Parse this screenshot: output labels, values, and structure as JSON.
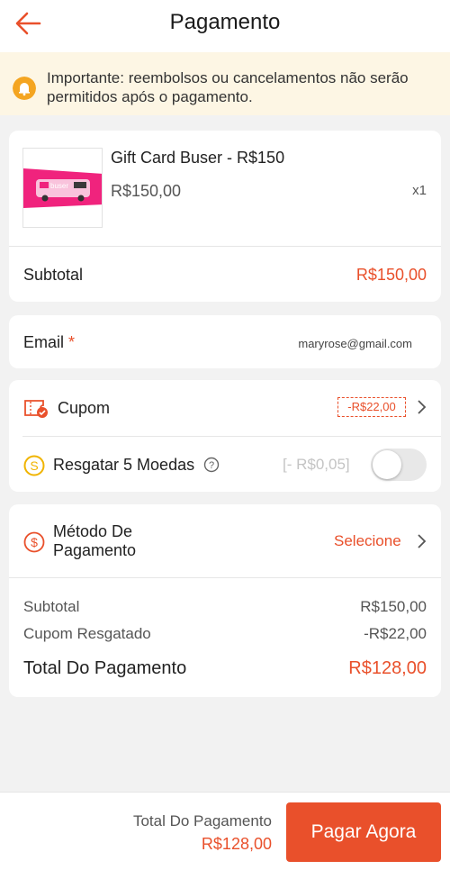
{
  "header": {
    "title": "Pagamento"
  },
  "notice": {
    "text": "Importante: reembolsos ou cancelamentos não serão permitidos após o pagamento."
  },
  "product": {
    "name": "Gift Card Buser - R$150",
    "price": "R$150,00",
    "quantity": "x1",
    "image_brand": "buser"
  },
  "subtotal_row": {
    "label": "Subtotal",
    "value": "R$150,00"
  },
  "email": {
    "label": "Email",
    "required_mark": "*",
    "value": "maryrose@gmail.com"
  },
  "coupon": {
    "label": "Cupom",
    "badge": "-R$22,00"
  },
  "coins": {
    "label": "Resgatar 5 Moedas",
    "value": "[- R$0,05]",
    "toggle_on": false
  },
  "payment_method": {
    "label_line1": "Método De",
    "label_line2": "Pagamento",
    "action": "Selecione"
  },
  "summary": {
    "subtotal_label": "Subtotal",
    "subtotal_value": "R$150,00",
    "coupon_label": "Cupom Resgatado",
    "coupon_value": "-R$22,00",
    "total_label": "Total Do Pagamento",
    "total_value": "R$128,00"
  },
  "footer": {
    "total_label": "Total Do Pagamento",
    "total_value": "R$128,00",
    "pay_button": "Pagar Agora"
  },
  "colors": {
    "accent": "#e9502b",
    "brand_pink": "#f0237d",
    "bell": "#f4a521",
    "coin": "#f0b400"
  },
  "icons": {
    "back": "arrow-left-icon",
    "notice": "bell-icon",
    "coupon": "coupon-icon",
    "coins": "coin-icon",
    "help": "question-icon",
    "payment": "dollar-circle-icon",
    "chevron": "chevron-right-icon"
  }
}
